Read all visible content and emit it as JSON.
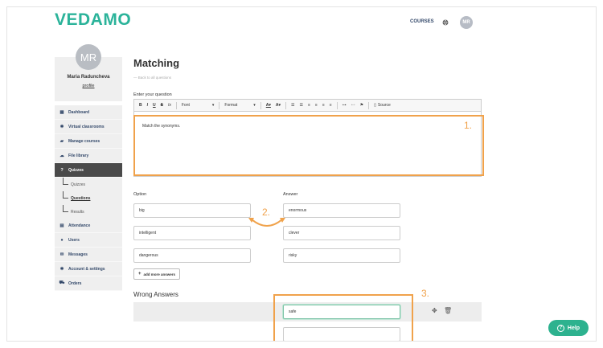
{
  "header": {
    "logo": "VEDAMO",
    "courses_label": "COURSES",
    "avatar_initials": "MR"
  },
  "sidebar": {
    "avatar_initials": "MR",
    "user_name": "Maria Raduncheva",
    "profile_link": "profile",
    "items": [
      {
        "label": "Dashboard",
        "icon": "grid-icon"
      },
      {
        "label": "Virtual classrooms",
        "icon": "gear-icon"
      },
      {
        "label": "Manage courses",
        "icon": "book-icon"
      },
      {
        "label": "File library",
        "icon": "cloud-icon"
      },
      {
        "label": "Quizzes",
        "icon": "question-icon"
      }
    ],
    "quiz_sub": [
      "Quizzes",
      "Questions",
      "Results"
    ],
    "items_after": [
      {
        "label": "Attendance",
        "icon": "calendar-icon"
      },
      {
        "label": "Users",
        "icon": "users-icon"
      },
      {
        "label": "Messages",
        "icon": "envelope-icon"
      },
      {
        "label": "Account & settings",
        "icon": "settings-icon"
      },
      {
        "label": "Orders",
        "icon": "cart-icon"
      }
    ]
  },
  "main": {
    "title": "Matching",
    "back_link": "— Back to all questions",
    "question_label": "Enter your question",
    "toolbar": {
      "font": "Font",
      "format": "Format",
      "source": "Source"
    },
    "question_text": "Match the synonyms.",
    "option_header": "Option",
    "answer_header": "Answer",
    "pairs": [
      {
        "option": "big",
        "answer": "enormous"
      },
      {
        "option": "intelligent",
        "answer": "clever"
      },
      {
        "option": "dangerous",
        "answer": "risky"
      }
    ],
    "add_more": "add more answers",
    "wrong_answers_label": "Wrong Answers",
    "wrong_answers": [
      "safe",
      ""
    ]
  },
  "annotations": {
    "step1": "1.",
    "step2": "2.",
    "step3": "3.",
    "color": "#f0a24b"
  },
  "help": {
    "label": "Help"
  },
  "colors": {
    "brand": "#2bb39a",
    "help": "#2db28f",
    "nav_text": "#354a6b"
  }
}
